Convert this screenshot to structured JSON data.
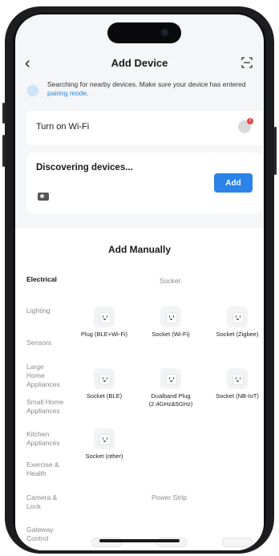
{
  "nav": {
    "title": "Add Device",
    "back_icon": "chevron-left-icon",
    "scan_icon": "scan-icon"
  },
  "hint": {
    "text": "Searching for nearby devices. Make sure your device has entered ",
    "link": "pairing mode",
    "end": "."
  },
  "wifi": {
    "label": "Turn on Wi-Fi",
    "badge": "!"
  },
  "discover": {
    "label": "Discovering devices...",
    "add_label": "Add"
  },
  "manual": {
    "header": "Add Manually",
    "categories": [
      "Electrical",
      "Lighting",
      "Sensors",
      "Large Home Appliances",
      "Small Home Appliances",
      "Kitchen Appliances",
      "Exercise & Health",
      "Camera & Lock",
      "Gateway Control"
    ],
    "sections": [
      {
        "title": "Socket",
        "items": [
          "Plug (BLE+Wi-Fi)",
          "Socket (Wi-Fi)",
          "Socket (Zigbee)",
          "Socket (BLE)",
          "Dualband Plug (2.4GHz&5GHz)",
          "Socket (NB-IoT)",
          "Socket (other)"
        ]
      },
      {
        "title": "Power Strip"
      }
    ]
  },
  "colors": {
    "accent": "#2b82e8",
    "link": "#2a82d8",
    "badge": "#e44545"
  }
}
